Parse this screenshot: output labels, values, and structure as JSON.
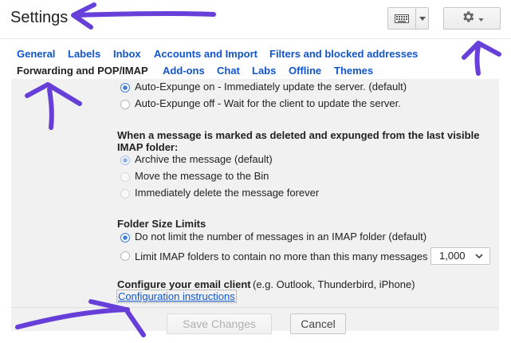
{
  "header": {
    "title": "Settings"
  },
  "tabs": [
    {
      "label": "General"
    },
    {
      "label": "Labels"
    },
    {
      "label": "Inbox"
    },
    {
      "label": "Accounts and Import"
    },
    {
      "label": "Filters and blocked addresses"
    },
    {
      "label": "Forwarding and POP/IMAP"
    },
    {
      "label": "Add-ons"
    },
    {
      "label": "Chat"
    },
    {
      "label": "Labs"
    },
    {
      "label": "Offline"
    },
    {
      "label": "Themes"
    }
  ],
  "expunge": {
    "options": [
      {
        "label": "Auto-Expunge on - Immediately update the server. (default)",
        "selected": true
      },
      {
        "label": "Auto-Expunge off - Wait for the client to update the server.",
        "selected": false
      }
    ]
  },
  "deleted": {
    "heading_line1": "When a message is marked as deleted and expunged from the last visible",
    "heading_line2": "IMAP folder:",
    "options": [
      {
        "label": "Archive the message (default)",
        "selected": true
      },
      {
        "label": "Move the message to the Bin",
        "selected": false
      },
      {
        "label": "Immediately delete the message forever",
        "selected": false
      }
    ]
  },
  "folder_size": {
    "heading": "Folder Size Limits",
    "options": [
      {
        "label": "Do not limit the number of messages in an IMAP folder (default)",
        "selected": true
      },
      {
        "label": "Limit IMAP folders to contain no more than this many messages",
        "selected": false
      }
    ],
    "limit_value": "1,000"
  },
  "client": {
    "heading": "Configure your email client",
    "examples": "(e.g. Outlook, Thunderbird, iPhone)",
    "link": "Configuration instructions"
  },
  "actions": {
    "save": "Save Changes",
    "cancel": "Cancel"
  },
  "colors": {
    "link": "#1155cc",
    "annotation": "#5b2fd6",
    "radio_selected": "#3f7ed8"
  },
  "icons": [
    "keyboard-icon",
    "chevron-down-icon",
    "gear-icon"
  ]
}
